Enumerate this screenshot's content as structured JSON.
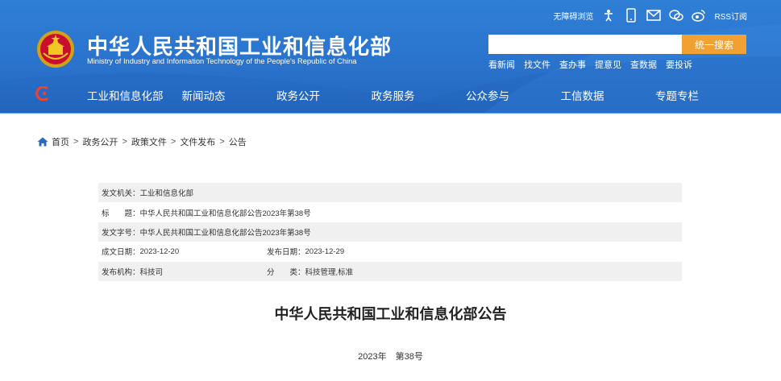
{
  "header": {
    "title": "中华人民共和国工业和信息化部",
    "subtitle": "Ministry of Industry and Information Technology of the People's Republic of China",
    "accessibility_label": "无障碍浏览",
    "rss_label": "RSS订阅",
    "icons": [
      "accessibility-icon",
      "mobile-icon",
      "mail-icon",
      "wechat-icon",
      "weibo-icon",
      "rss-icon"
    ],
    "brand_color": "#2a73cc",
    "accent_color": "#f0a132"
  },
  "search": {
    "placeholder": "",
    "button_label": "统一搜索"
  },
  "quick_links": [
    "看新闻",
    "找文件",
    "查办事",
    "提意见",
    "查数据",
    "要投诉"
  ],
  "nav": [
    "工业和信息化部",
    "新闻动态",
    "政务公开",
    "政务服务",
    "公众参与",
    "工信数据",
    "专题专栏"
  ],
  "breadcrumb": [
    "首页",
    "政务公开",
    "政策文件",
    "文件发布",
    "公告"
  ],
  "meta": {
    "issuer_label": "发文机关：",
    "issuer": "工业和信息化部",
    "title_label": "标　　题：",
    "title": "中华人民共和国工业和信息化部公告2023年第38号",
    "docno_label": "发文字号：",
    "docno": "中华人民共和国工业和信息化部公告2023年第38号",
    "created_label": "成文日期：",
    "created": "2023-12-20",
    "published_label": "发布日期：",
    "published": "2023-12-29",
    "agency_label": "发布机构：",
    "agency": "科技司",
    "category_label": "分　　类：",
    "category": "科技管理,标准"
  },
  "document": {
    "title": "中华人民共和国工业和信息化部公告",
    "number": "2023年　第38号"
  }
}
